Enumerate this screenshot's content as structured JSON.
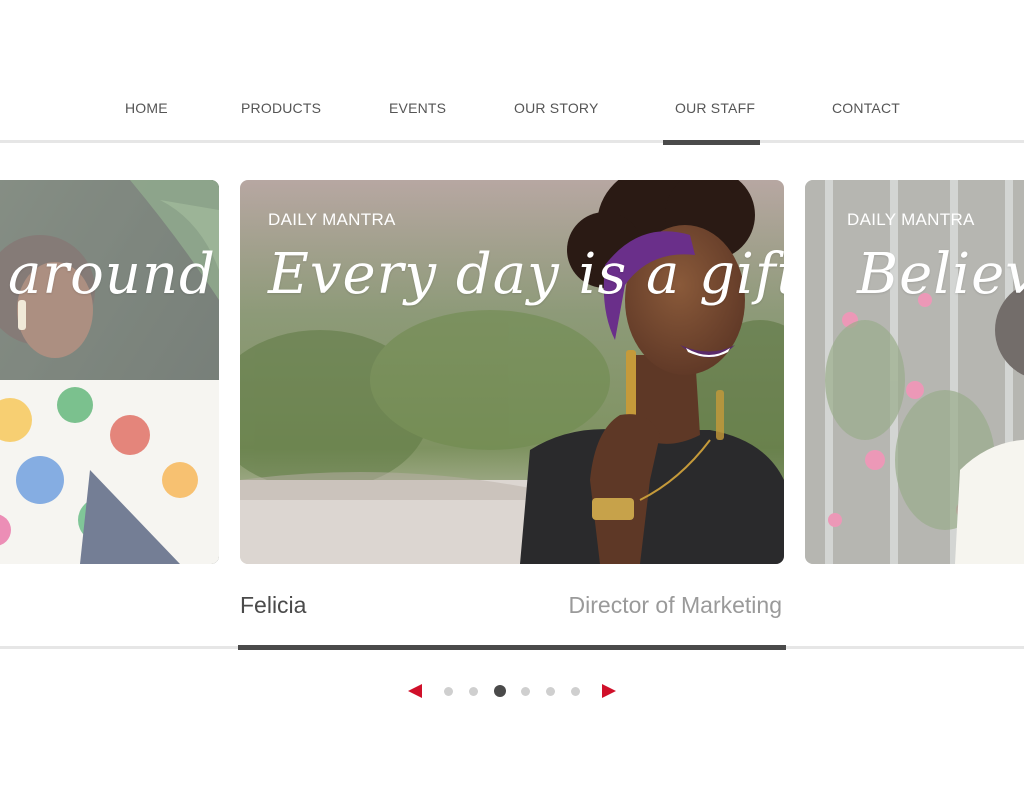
{
  "nav": {
    "items": [
      "HOME",
      "PRODUCTS",
      "EVENTS",
      "OUR STORY",
      "OUR STAFF",
      "CONTACT"
    ],
    "active_index": 4
  },
  "carousel": {
    "cards": [
      {
        "mantra_text": "around."
      },
      {
        "label": "DAILY MANTRA",
        "mantra_text": "Every day is a gift."
      },
      {
        "label": "DAILY MANTRA",
        "mantra_text": "Believe"
      }
    ],
    "current": {
      "name": "Felicia",
      "role": "Director of Marketing"
    },
    "pager": {
      "total": 6,
      "active_index": 2,
      "prev_icon": "triangle-left-icon",
      "next_icon": "triangle-right-icon"
    }
  },
  "colors": {
    "accent": "#d0102a",
    "text": "#4a4a4a",
    "muted": "#9a9a9a",
    "rule": "#e6e6e6",
    "dot": "#cfcfcf"
  }
}
